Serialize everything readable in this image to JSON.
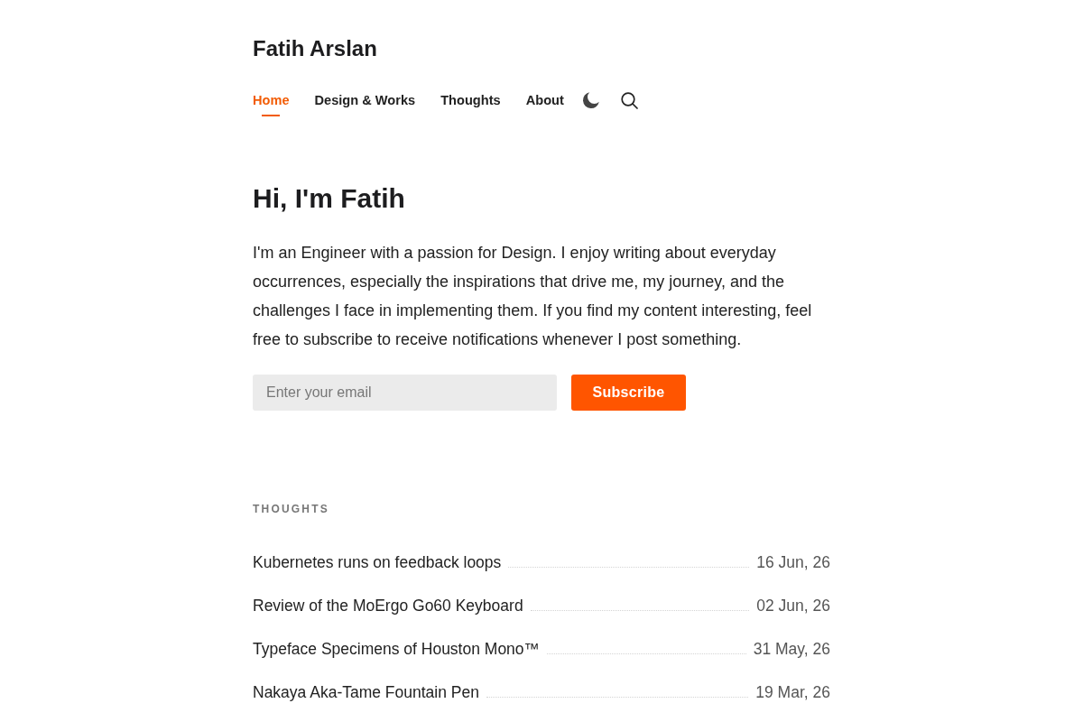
{
  "site_title": "Fatih Arslan",
  "nav": {
    "items": [
      {
        "label": "Home",
        "selected": true
      },
      {
        "label": "Design & Works",
        "selected": false
      },
      {
        "label": "Thoughts",
        "selected": false
      },
      {
        "label": "About",
        "selected": false
      }
    ]
  },
  "intro": {
    "heading": "Hi, I'm Fatih",
    "text": "I'm an Engineer with a passion for Design. I enjoy writing about everyday occurrences, especially the inspirations that drive me, my journey, and the challenges I face in implementing them. If you find my content interesting, feel free to subscribe to receive notifications whenever I post something."
  },
  "subscribe": {
    "placeholder": "Enter your email",
    "button": "Subscribe"
  },
  "thoughts": {
    "heading": "THOUGHTS",
    "posts": [
      {
        "title": "Kubernetes runs on feedback loops",
        "date": "16 Jun, 26"
      },
      {
        "title": "Review of the MoErgo Go60 Keyboard",
        "date": "02 Jun, 26"
      },
      {
        "title": "Typeface Specimens of Houston Mono™",
        "date": "31 May, 26"
      },
      {
        "title": "Nakaya Aka-Tame Fountain Pen",
        "date": "19 Mar, 26"
      }
    ]
  }
}
